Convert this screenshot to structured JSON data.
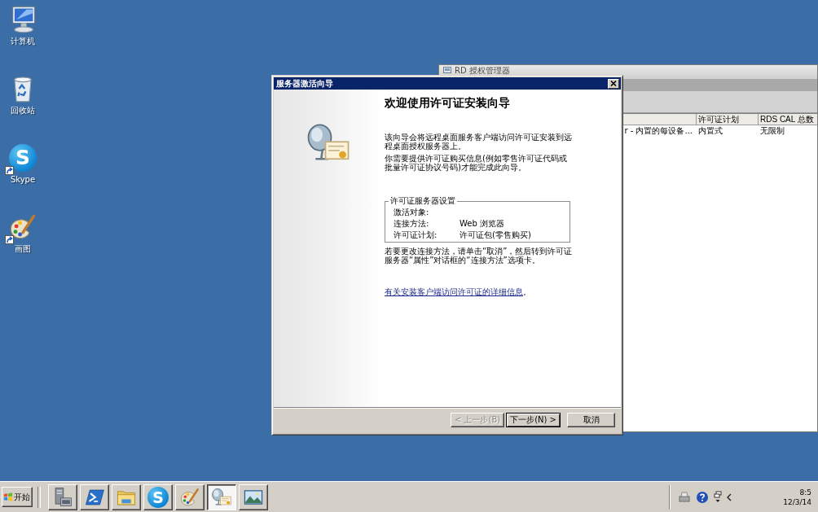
{
  "desktop_icons": [
    {
      "label": "计算机",
      "kind": "computer",
      "shortcut": false
    },
    {
      "label": "回收站",
      "kind": "recycle-bin",
      "shortcut": false
    },
    {
      "label": "Skype",
      "kind": "skype",
      "logo_text": "S",
      "shortcut": true
    },
    {
      "label": "画图",
      "kind": "paint",
      "shortcut": true
    }
  ],
  "background_window": {
    "title": "RD 授权管理器",
    "columns": [
      "",
      "许可证计划",
      "RDS CAL 总数"
    ],
    "rows": [
      {
        "cells": [
          "r - 内置的每设备...",
          "内置式",
          "无限制"
        ]
      }
    ]
  },
  "dialog": {
    "title": "服务器激活向导",
    "heading": "欢迎使用许可证安装向导",
    "paragraphs": [
      "该向导会将远程桌面服务客户端访问许可证安装到远程桌面授权服务器上。",
      "你需要提供许可证购买信息(例如零售许可证代码或批量许可证协议号码)才能完成此向导。"
    ],
    "settings_group": {
      "legend": "许可证服务器设置",
      "rows": [
        {
          "label": "激活对象:"
        },
        {
          "label": "连接方法:",
          "value": "Web 浏览器"
        },
        {
          "label": "许可证计划:",
          "value": "许可证包(零售购买)"
        }
      ]
    },
    "note": "若要更改连接方法，请单击“取消”，然后转到许可证服务器“属性”对话框的“连接方法”选项卡。",
    "link": "有关安装客户端访问许可证的详细信息",
    "link_suffix": "。",
    "buttons": [
      {
        "label": "< 上一步(B)",
        "disabled": true,
        "focused": false
      },
      {
        "label": "下一步(N) >",
        "disabled": false,
        "focused": true
      },
      {
        "label": "取消",
        "disabled": false,
        "focused": false
      }
    ]
  },
  "taskbar": {
    "start_label": "开始",
    "items": [
      {
        "kind": "server-manager",
        "active": false
      },
      {
        "kind": "powershell",
        "active": false
      },
      {
        "kind": "explorer",
        "active": false
      },
      {
        "kind": "skype",
        "logo_text": "S",
        "active": false
      },
      {
        "kind": "paint",
        "active": false
      },
      {
        "kind": "wizard",
        "active": true
      },
      {
        "kind": "picture",
        "active": false
      }
    ],
    "clock": {
      "time": "8:5",
      "date": "12/3/14"
    }
  }
}
